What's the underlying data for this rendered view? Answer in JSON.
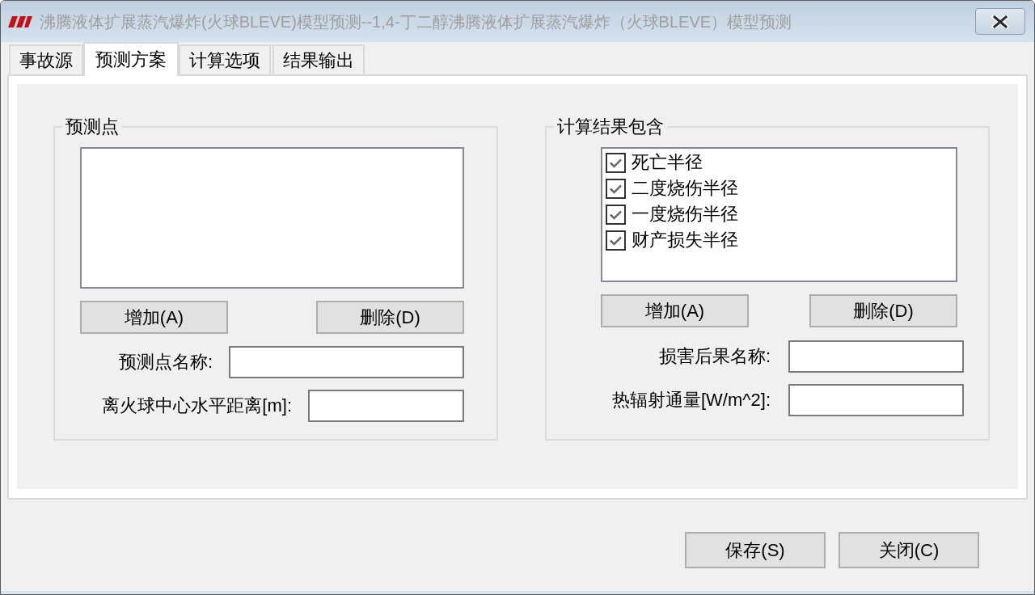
{
  "window": {
    "title": "沸腾液体扩展蒸汽爆炸(火球BLEVE)模型预测--1,4-丁二醇沸腾液体扩展蒸汽爆炸（火球BLEVE）模型预测"
  },
  "tabs": [
    {
      "label": "事故源",
      "selected": false
    },
    {
      "label": "预测方案",
      "selected": true
    },
    {
      "label": "计算选项",
      "selected": false
    },
    {
      "label": "结果输出",
      "selected": false
    }
  ],
  "prediction_points": {
    "title": "预测点",
    "buttons": [
      "增加(A)",
      "删除(D)"
    ],
    "fields": [
      {
        "label": "预测点名称:"
      },
      {
        "label": "离火球中心水平距离[m]:"
      }
    ]
  },
  "results_included": {
    "title": "计算结果包含",
    "items": [
      {
        "label": "死亡半径",
        "checked": true
      },
      {
        "label": "二度烧伤半径",
        "checked": true
      },
      {
        "label": "一度烧伤半径",
        "checked": true
      },
      {
        "label": "财产损失半径",
        "checked": true
      }
    ],
    "buttons": [
      "增加(A)",
      "删除(D)"
    ],
    "fields": [
      {
        "label": "损害后果名称:"
      },
      {
        "label": "热辐射通量[W/m^2]:"
      }
    ]
  },
  "dialog_buttons": [
    "保存(S)",
    "关闭(C)"
  ]
}
